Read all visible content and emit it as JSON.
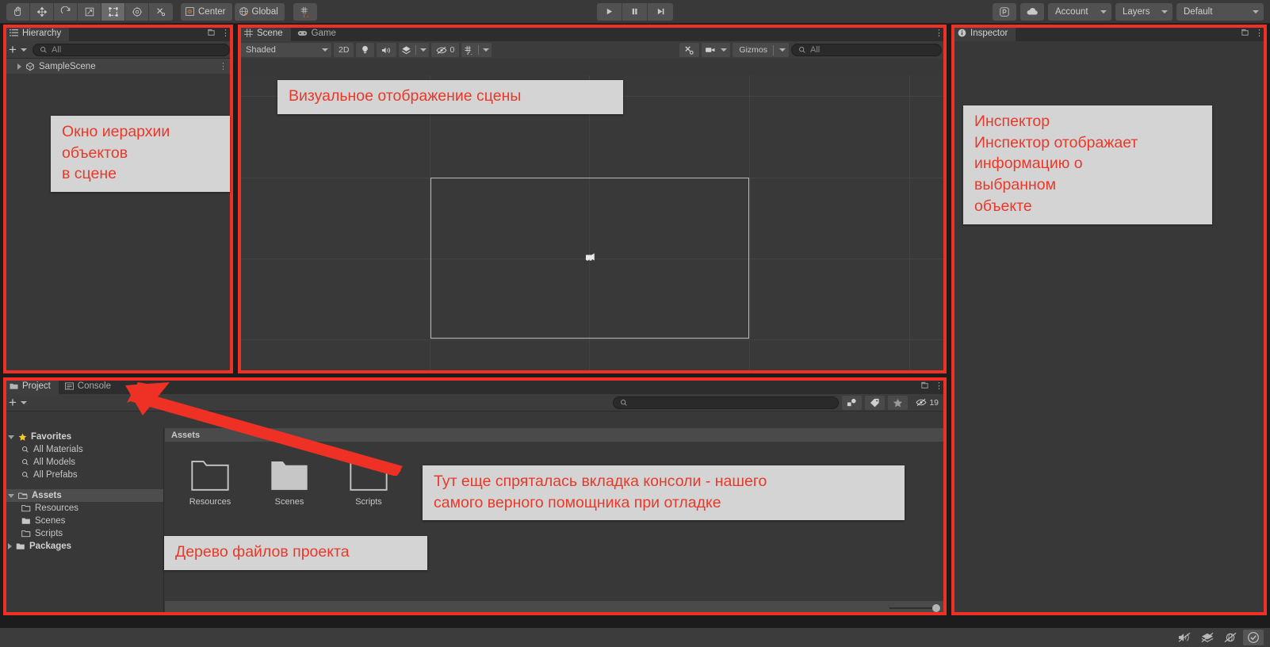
{
  "app": {
    "title": "Unity Editor"
  },
  "toolbar": {
    "tools": [
      {
        "name": "hand-tool",
        "icon": "hand",
        "selected": false
      },
      {
        "name": "move-tool",
        "icon": "move",
        "selected": false
      },
      {
        "name": "rotate-tool",
        "icon": "rotate",
        "selected": false
      },
      {
        "name": "scale-tool",
        "icon": "scale",
        "selected": false
      },
      {
        "name": "rect-tool",
        "icon": "rect",
        "selected": true
      },
      {
        "name": "transform-tool",
        "icon": "transform",
        "selected": false
      },
      {
        "name": "custom-tool",
        "icon": "wrench",
        "selected": false
      }
    ],
    "pivot_mode": "Center",
    "pivot_rotation": "Global",
    "snap_label": "grid-snap",
    "play": "play-button",
    "pause": "pause-button",
    "step": "step-button",
    "collab_icon": "collab-icon",
    "cloud_icon": "cloud-icon",
    "account": "Account",
    "layers": "Layers",
    "layout": "Default"
  },
  "hierarchy": {
    "tab_label": "Hierarchy",
    "tab_icon": "hierarchy-icon",
    "search_placeholder": "All",
    "create_label": "+",
    "items": [
      {
        "label": "SampleScene",
        "expanded": false,
        "icon": "scene-icon"
      }
    ]
  },
  "scene": {
    "tabs": [
      {
        "label": "Scene",
        "icon": "grid-icon",
        "active": true
      },
      {
        "label": "Game",
        "icon": "gamepad-icon",
        "active": false
      }
    ],
    "draw_mode": "Shaded",
    "two_d": "2D",
    "lighting_icon": "lightbulb-icon",
    "audio_icon": "speaker-icon",
    "fx_icon": "effects-icon",
    "hidden_count": "0",
    "grid_icon": "grid-visibility-icon",
    "tools_icon": "tools-icon",
    "camera_icon": "camera-icon",
    "gizmos_label": "Gizmos",
    "search_placeholder": "All"
  },
  "inspector": {
    "tab_label": "Inspector",
    "tab_icon": "info-icon"
  },
  "project": {
    "tabs": [
      {
        "label": "Project",
        "icon": "folder-icon",
        "active": true
      },
      {
        "label": "Console",
        "icon": "console-icon",
        "active": false
      }
    ],
    "create_label": "+",
    "search_placeholder": "",
    "search_value": "",
    "filter_icons": [
      "object-filter-icon",
      "label-filter-icon",
      "favorite-filter-icon"
    ],
    "hidden_count": "19",
    "tree": [
      {
        "label": "Favorites",
        "icon": "star-icon",
        "depth": 0,
        "expanded": true,
        "bold": true,
        "selected": false
      },
      {
        "label": "All Materials",
        "icon": "search-icon",
        "depth": 1,
        "bold": false,
        "selected": false
      },
      {
        "label": "All Models",
        "icon": "search-icon",
        "depth": 1,
        "bold": false,
        "selected": false
      },
      {
        "label": "All Prefabs",
        "icon": "search-icon",
        "depth": 1,
        "bold": false,
        "selected": false
      },
      {
        "label": "Assets",
        "icon": "folder-open-icon",
        "depth": 0,
        "expanded": true,
        "bold": true,
        "selected": true
      },
      {
        "label": "Resources",
        "icon": "folder-outline-icon",
        "depth": 1,
        "bold": false,
        "selected": false
      },
      {
        "label": "Scenes",
        "icon": "folder-solid-icon",
        "depth": 1,
        "bold": false,
        "selected": false
      },
      {
        "label": "Scripts",
        "icon": "folder-outline-icon",
        "depth": 1,
        "bold": false,
        "selected": false
      },
      {
        "label": "Packages",
        "icon": "folder-solid-icon",
        "depth": 0,
        "expanded": false,
        "bold": true,
        "selected": false
      }
    ],
    "breadcrumb": "Assets",
    "items": [
      {
        "label": "Resources",
        "icon": "folder-outline-icon"
      },
      {
        "label": "Scenes",
        "icon": "folder-solid-icon"
      },
      {
        "label": "Scripts",
        "icon": "folder-outline-icon"
      }
    ]
  },
  "statusbar": {
    "icons": [
      "mute-audio-icon",
      "layers-off-icon",
      "gizmos-off-icon",
      "check-icon"
    ]
  },
  "annotations": {
    "accent_color": "#ee3124",
    "box_background": "#d4d4d4",
    "callouts": [
      {
        "id": "hierarchy-note",
        "text": "Окно иерархии\nобъектов\nв сцене"
      },
      {
        "id": "scene-note",
        "text": "Визуальное отображение сцены"
      },
      {
        "id": "inspector-note",
        "text": "Инспектор\nИнспектор отображает\nинформацию о\nвыбранном\nобъекте"
      },
      {
        "id": "console-note",
        "text": "Тут еще спряталась вкладка консоли - нашего\nсамого верного помощника при отладке"
      },
      {
        "id": "project-tree-note",
        "text": "Дерево файлов проекта"
      }
    ]
  }
}
